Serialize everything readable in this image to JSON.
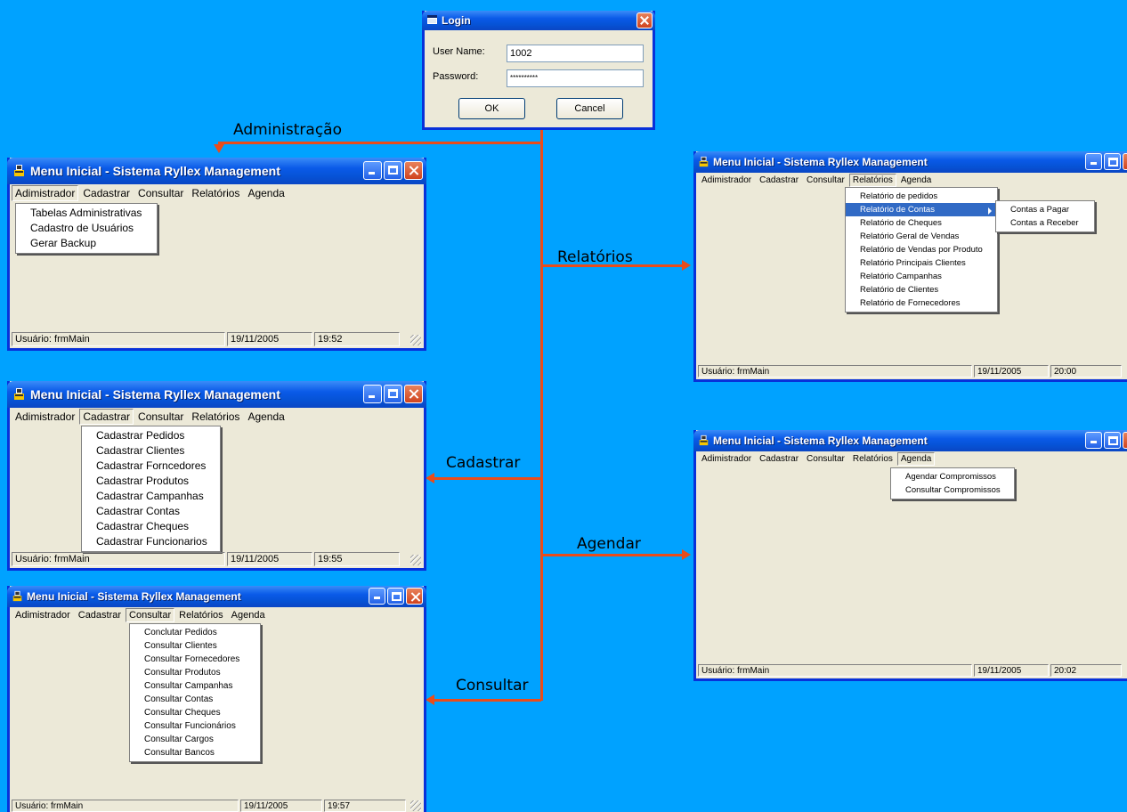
{
  "login": {
    "title": "Login",
    "username_label": "User Name:",
    "username_value": "1002",
    "password_label": "Password:",
    "password_value": "**********",
    "ok_label": "OK",
    "cancel_label": "Cancel"
  },
  "arrows": {
    "admin": "Administração",
    "relatorios": "Relatórios",
    "cadastrar": "Cadastrar",
    "agendar": "Agendar",
    "consultar": "Consultar"
  },
  "colors": {
    "background": "#00a2ff",
    "connector": "#ea4c1a",
    "titlebar": "#0a5ae8",
    "menu_highlight": "#316ac5"
  },
  "app_title": "Menu Inicial - Sistema Ryllex Management",
  "status_user": "Usuário: frmMain",
  "windows": {
    "admin": {
      "menu": [
        "Adimistrador",
        "Cadastrar",
        "Consultar",
        "Relatórios",
        "Agenda"
      ],
      "items": [
        "Tabelas Administrativas",
        "Cadastro de Usuários",
        "Gerar Backup"
      ],
      "date": "19/11/2005",
      "time": "19:52"
    },
    "cadastrar": {
      "menu": [
        "Adimistrador",
        "Cadastrar",
        "Consultar",
        "Relatórios",
        "Agenda"
      ],
      "items": [
        "Cadastrar Pedidos",
        "Cadastrar Clientes",
        "Cadastrar Forncedores",
        "Cadastrar Produtos",
        "Cadastrar Campanhas",
        "Cadastrar Contas",
        "Cadastrar Cheques",
        "Cadastrar Funcionarios"
      ],
      "date": "19/11/2005",
      "time": "19:55"
    },
    "consultar": {
      "menu": [
        "Adimistrador",
        "Cadastrar",
        "Consultar",
        "Relatórios",
        "Agenda"
      ],
      "items": [
        "Conclutar Pedidos",
        "Consultar Clientes",
        "Consultar Fornecedores",
        "Consultar Produtos",
        "Consultar Campanhas",
        "Consultar Contas",
        "Consultar Cheques",
        "Consultar Funcionários",
        "Consultar Cargos",
        "Consultar Bancos"
      ],
      "date": "19/11/2005",
      "time": "19:57"
    },
    "relatorios": {
      "menu": [
        "Adimistrador",
        "Cadastrar",
        "Consultar",
        "Relatórios",
        "Agenda"
      ],
      "items": [
        "Relatório de pedidos",
        "Relatório de Contas",
        "Relatório de Cheques",
        "Relatório Geral de Vendas",
        "Relatório de Vendas por Produto",
        "Relatório Principais Clientes",
        "Relatório Campanhas",
        "Relatório de Clientes",
        "Relatório de Fornecedores"
      ],
      "submenu": [
        "Contas a Pagar",
        "Contas a Receber"
      ],
      "date": "19/11/2005",
      "time": "20:00"
    },
    "agenda": {
      "menu": [
        "Adimistrador",
        "Cadastrar",
        "Consultar",
        "Relatórios",
        "Agenda"
      ],
      "items": [
        "Agendar Compromissos",
        "Consultar Compromissos"
      ],
      "date": "19/11/2005",
      "time": "20:02"
    }
  }
}
